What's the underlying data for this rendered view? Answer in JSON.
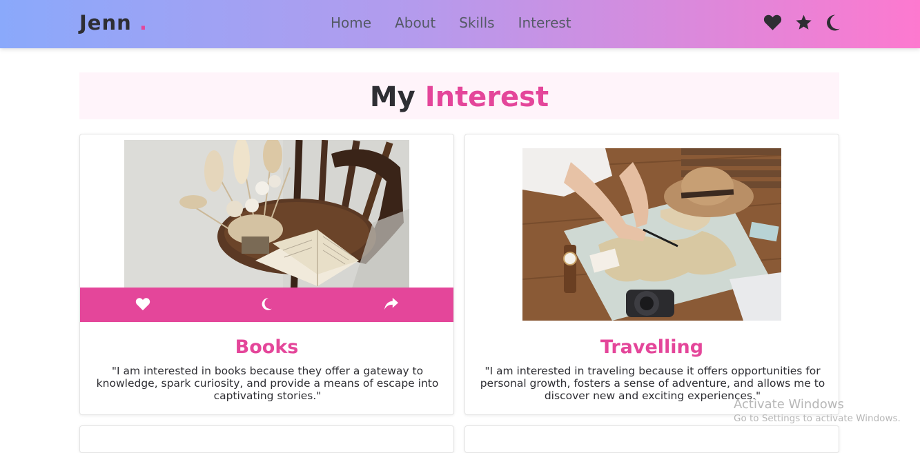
{
  "header": {
    "logo_text": "Jenn",
    "logo_dot": ".",
    "nav": [
      "Home",
      "About",
      "Skills",
      "Interest"
    ],
    "icons": [
      "heart-icon",
      "star-icon",
      "moon-icon"
    ]
  },
  "section": {
    "title_main": "My",
    "title_accent": "Interest"
  },
  "cards": [
    {
      "title": "Books",
      "text": "\"I am interested in books because they offer a gateway to knowledge, spark curiosity, and provide a means of escape into captivating stories.\"",
      "actions": [
        "heart-icon",
        "moon-icon",
        "share-icon"
      ]
    },
    {
      "title": "Travelling",
      "text": "\"I am interested in traveling because it offers opportunities for personal growth, fosters a sense of adventure, and allows me to discover new and exciting experiences.\""
    }
  ],
  "watermark": {
    "title": "Activate Windows",
    "subtitle": "Go to Settings to activate Windows."
  },
  "colors": {
    "accent": "#e4469a",
    "text_dark": "#2e2e33",
    "header_gradient_start": "#8aa9fb",
    "header_gradient_end": "#fd79cf"
  }
}
